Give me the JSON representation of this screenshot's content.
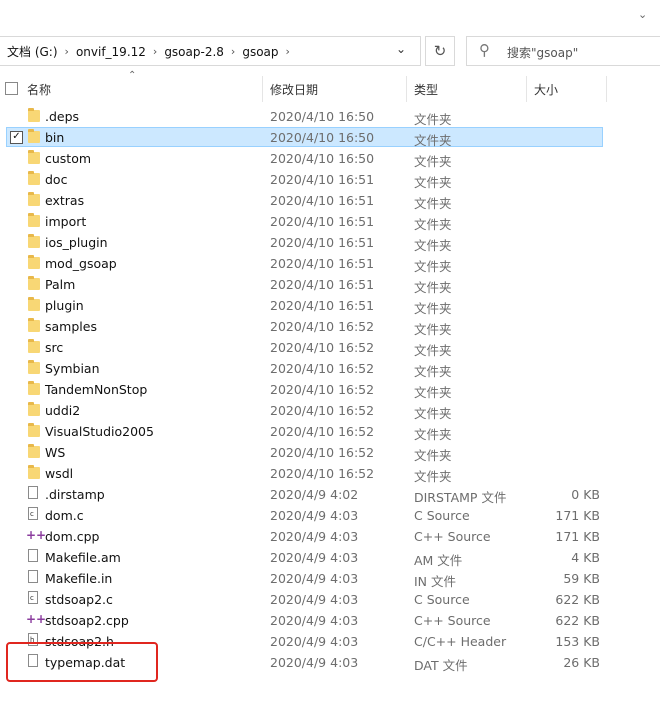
{
  "address": {
    "crumbs": [
      "文档 (G:)",
      "onvif_19.12",
      "gsoap-2.8",
      "gsoap"
    ],
    "separator": "›"
  },
  "search": {
    "placeholder": "搜索\"gsoap\""
  },
  "columns": {
    "name": "名称",
    "date": "修改日期",
    "type": "类型",
    "size": "大小"
  },
  "files": [
    {
      "name": ".deps",
      "date": "2020/4/10 16:50",
      "type": "文件夹",
      "size": "",
      "icon": "folder"
    },
    {
      "name": "bin",
      "date": "2020/4/10 16:50",
      "type": "文件夹",
      "size": "",
      "icon": "folder",
      "selected": true
    },
    {
      "name": "custom",
      "date": "2020/4/10 16:50",
      "type": "文件夹",
      "size": "",
      "icon": "folder"
    },
    {
      "name": "doc",
      "date": "2020/4/10 16:51",
      "type": "文件夹",
      "size": "",
      "icon": "folder"
    },
    {
      "name": "extras",
      "date": "2020/4/10 16:51",
      "type": "文件夹",
      "size": "",
      "icon": "folder"
    },
    {
      "name": "import",
      "date": "2020/4/10 16:51",
      "type": "文件夹",
      "size": "",
      "icon": "folder"
    },
    {
      "name": "ios_plugin",
      "date": "2020/4/10 16:51",
      "type": "文件夹",
      "size": "",
      "icon": "folder"
    },
    {
      "name": "mod_gsoap",
      "date": "2020/4/10 16:51",
      "type": "文件夹",
      "size": "",
      "icon": "folder"
    },
    {
      "name": "Palm",
      "date": "2020/4/10 16:51",
      "type": "文件夹",
      "size": "",
      "icon": "folder"
    },
    {
      "name": "plugin",
      "date": "2020/4/10 16:51",
      "type": "文件夹",
      "size": "",
      "icon": "folder"
    },
    {
      "name": "samples",
      "date": "2020/4/10 16:52",
      "type": "文件夹",
      "size": "",
      "icon": "folder"
    },
    {
      "name": "src",
      "date": "2020/4/10 16:52",
      "type": "文件夹",
      "size": "",
      "icon": "folder"
    },
    {
      "name": "Symbian",
      "date": "2020/4/10 16:52",
      "type": "文件夹",
      "size": "",
      "icon": "folder"
    },
    {
      "name": "TandemNonStop",
      "date": "2020/4/10 16:52",
      "type": "文件夹",
      "size": "",
      "icon": "folder"
    },
    {
      "name": "uddi2",
      "date": "2020/4/10 16:52",
      "type": "文件夹",
      "size": "",
      "icon": "folder"
    },
    {
      "name": "VisualStudio2005",
      "date": "2020/4/10 16:52",
      "type": "文件夹",
      "size": "",
      "icon": "folder"
    },
    {
      "name": "WS",
      "date": "2020/4/10 16:52",
      "type": "文件夹",
      "size": "",
      "icon": "folder"
    },
    {
      "name": "wsdl",
      "date": "2020/4/10 16:52",
      "type": "文件夹",
      "size": "",
      "icon": "folder"
    },
    {
      "name": ".dirstamp",
      "date": "2020/4/9 4:02",
      "type": "DIRSTAMP 文件",
      "size": "0 KB",
      "icon": "file"
    },
    {
      "name": "dom.c",
      "date": "2020/4/9 4:03",
      "type": "C Source",
      "size": "171 KB",
      "icon": "c-file"
    },
    {
      "name": "dom.cpp",
      "date": "2020/4/9 4:03",
      "type": "C++ Source",
      "size": "171 KB",
      "icon": "cpp-file"
    },
    {
      "name": "Makefile.am",
      "date": "2020/4/9 4:03",
      "type": "AM 文件",
      "size": "4 KB",
      "icon": "file"
    },
    {
      "name": "Makefile.in",
      "date": "2020/4/9 4:03",
      "type": "IN 文件",
      "size": "59 KB",
      "icon": "file"
    },
    {
      "name": "stdsoap2.c",
      "date": "2020/4/9 4:03",
      "type": "C Source",
      "size": "622 KB",
      "icon": "c-file"
    },
    {
      "name": "stdsoap2.cpp",
      "date": "2020/4/9 4:03",
      "type": "C++ Source",
      "size": "622 KB",
      "icon": "cpp-file"
    },
    {
      "name": "stdsoap2.h",
      "date": "2020/4/9 4:03",
      "type": "C/C++ Header",
      "size": "153 KB",
      "icon": "h-file"
    },
    {
      "name": "typemap.dat",
      "date": "2020/4/9 4:03",
      "type": "DAT 文件",
      "size": "26 KB",
      "icon": "file"
    }
  ],
  "colors": {
    "selection": "#cce8ff",
    "selection_border": "#99d1ff",
    "folder": "#f8d775",
    "highlight_box": "#e0261f"
  }
}
